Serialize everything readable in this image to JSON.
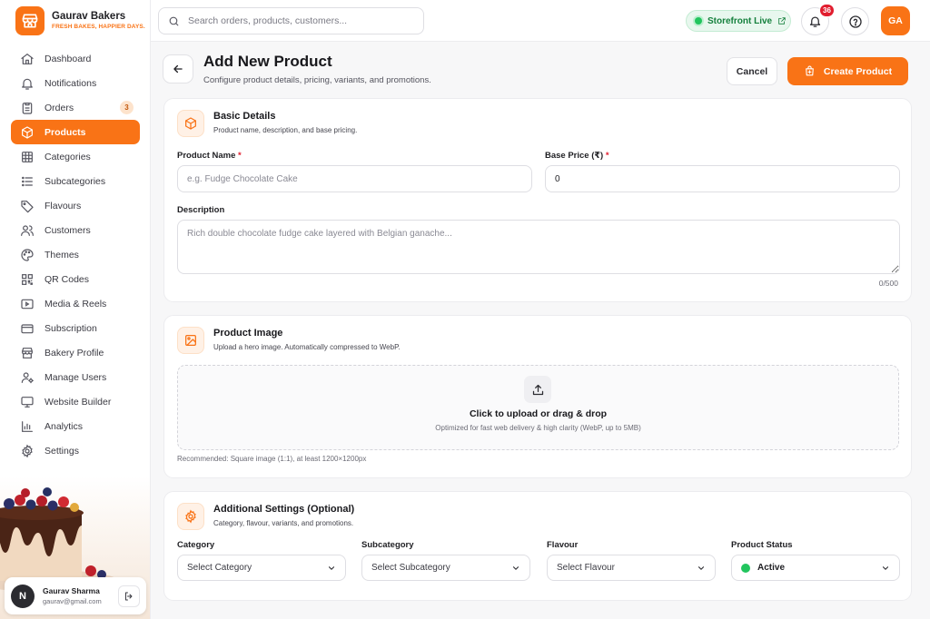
{
  "brand": {
    "name": "Gaurav Bakers",
    "tagline": "FRESH BAKES, HAPPIER DAYS."
  },
  "nav": [
    {
      "label": "Dashboard",
      "icon": "home-icon"
    },
    {
      "label": "Notifications",
      "icon": "bell-icon"
    },
    {
      "label": "Orders",
      "icon": "clipboard-icon",
      "badge": "3"
    },
    {
      "label": "Products",
      "icon": "box-icon",
      "active": true
    },
    {
      "label": "Categories",
      "icon": "grid-icon"
    },
    {
      "label": "Subcategories",
      "icon": "list-icon"
    },
    {
      "label": "Flavours",
      "icon": "tag-icon"
    },
    {
      "label": "Customers",
      "icon": "users-icon"
    },
    {
      "label": "Themes",
      "icon": "palette-icon"
    },
    {
      "label": "QR Codes",
      "icon": "qr-icon"
    },
    {
      "label": "Media & Reels",
      "icon": "media-icon"
    },
    {
      "label": "Subscription",
      "icon": "card-icon"
    },
    {
      "label": "Bakery Profile",
      "icon": "store-icon"
    },
    {
      "label": "Manage Users",
      "icon": "user-cog-icon"
    },
    {
      "label": "Website Builder",
      "icon": "monitor-icon"
    },
    {
      "label": "Analytics",
      "icon": "bar-chart-icon"
    },
    {
      "label": "Settings",
      "icon": "gear-icon"
    }
  ],
  "user": {
    "initial": "N",
    "name": "Gaurav Sharma",
    "email": "gaurav@gmail.com"
  },
  "topbar": {
    "search_placeholder": "Search orders, products, customers...",
    "storefront_label": "Storefront Live",
    "notification_count": "36",
    "avatar_initials": "GA"
  },
  "header": {
    "title": "Add New Product",
    "subtitle": "Configure product details, pricing, variants, and promotions.",
    "cancel_label": "Cancel",
    "create_label": "Create Product"
  },
  "basic": {
    "title": "Basic Details",
    "subtitle": "Product name, description, and base pricing.",
    "name_label": "Product Name",
    "name_placeholder": "e.g. Fudge Chocolate Cake",
    "price_label": "Base Price (₹)",
    "price_value": "0",
    "required_mark": "*",
    "desc_label": "Description",
    "desc_placeholder": "Rich double chocolate fudge cake layered with Belgian ganache...",
    "char_count": "0/500"
  },
  "image": {
    "title": "Product Image",
    "subtitle": "Upload a hero image. Automatically compressed to WebP.",
    "drop_title": "Click to upload or drag & drop",
    "drop_hint": "Optimized for fast web delivery & high clarity (WebP, up to 5MB)",
    "recommendation": "Recommended: Square image (1:1), at least 1200×1200px"
  },
  "additional": {
    "title": "Additional Settings (Optional)",
    "subtitle": "Category, flavour, variants, and promotions.",
    "fields": [
      {
        "label": "Category",
        "value": "Select Category"
      },
      {
        "label": "Subcategory",
        "value": "Select Subcategory"
      },
      {
        "label": "Flavour",
        "value": "Select Flavour"
      },
      {
        "label": "Product Status",
        "value": "Active"
      }
    ]
  },
  "colors": {
    "accent": "#f97316",
    "live": "#22c55e",
    "badge": "#e11d2e"
  }
}
